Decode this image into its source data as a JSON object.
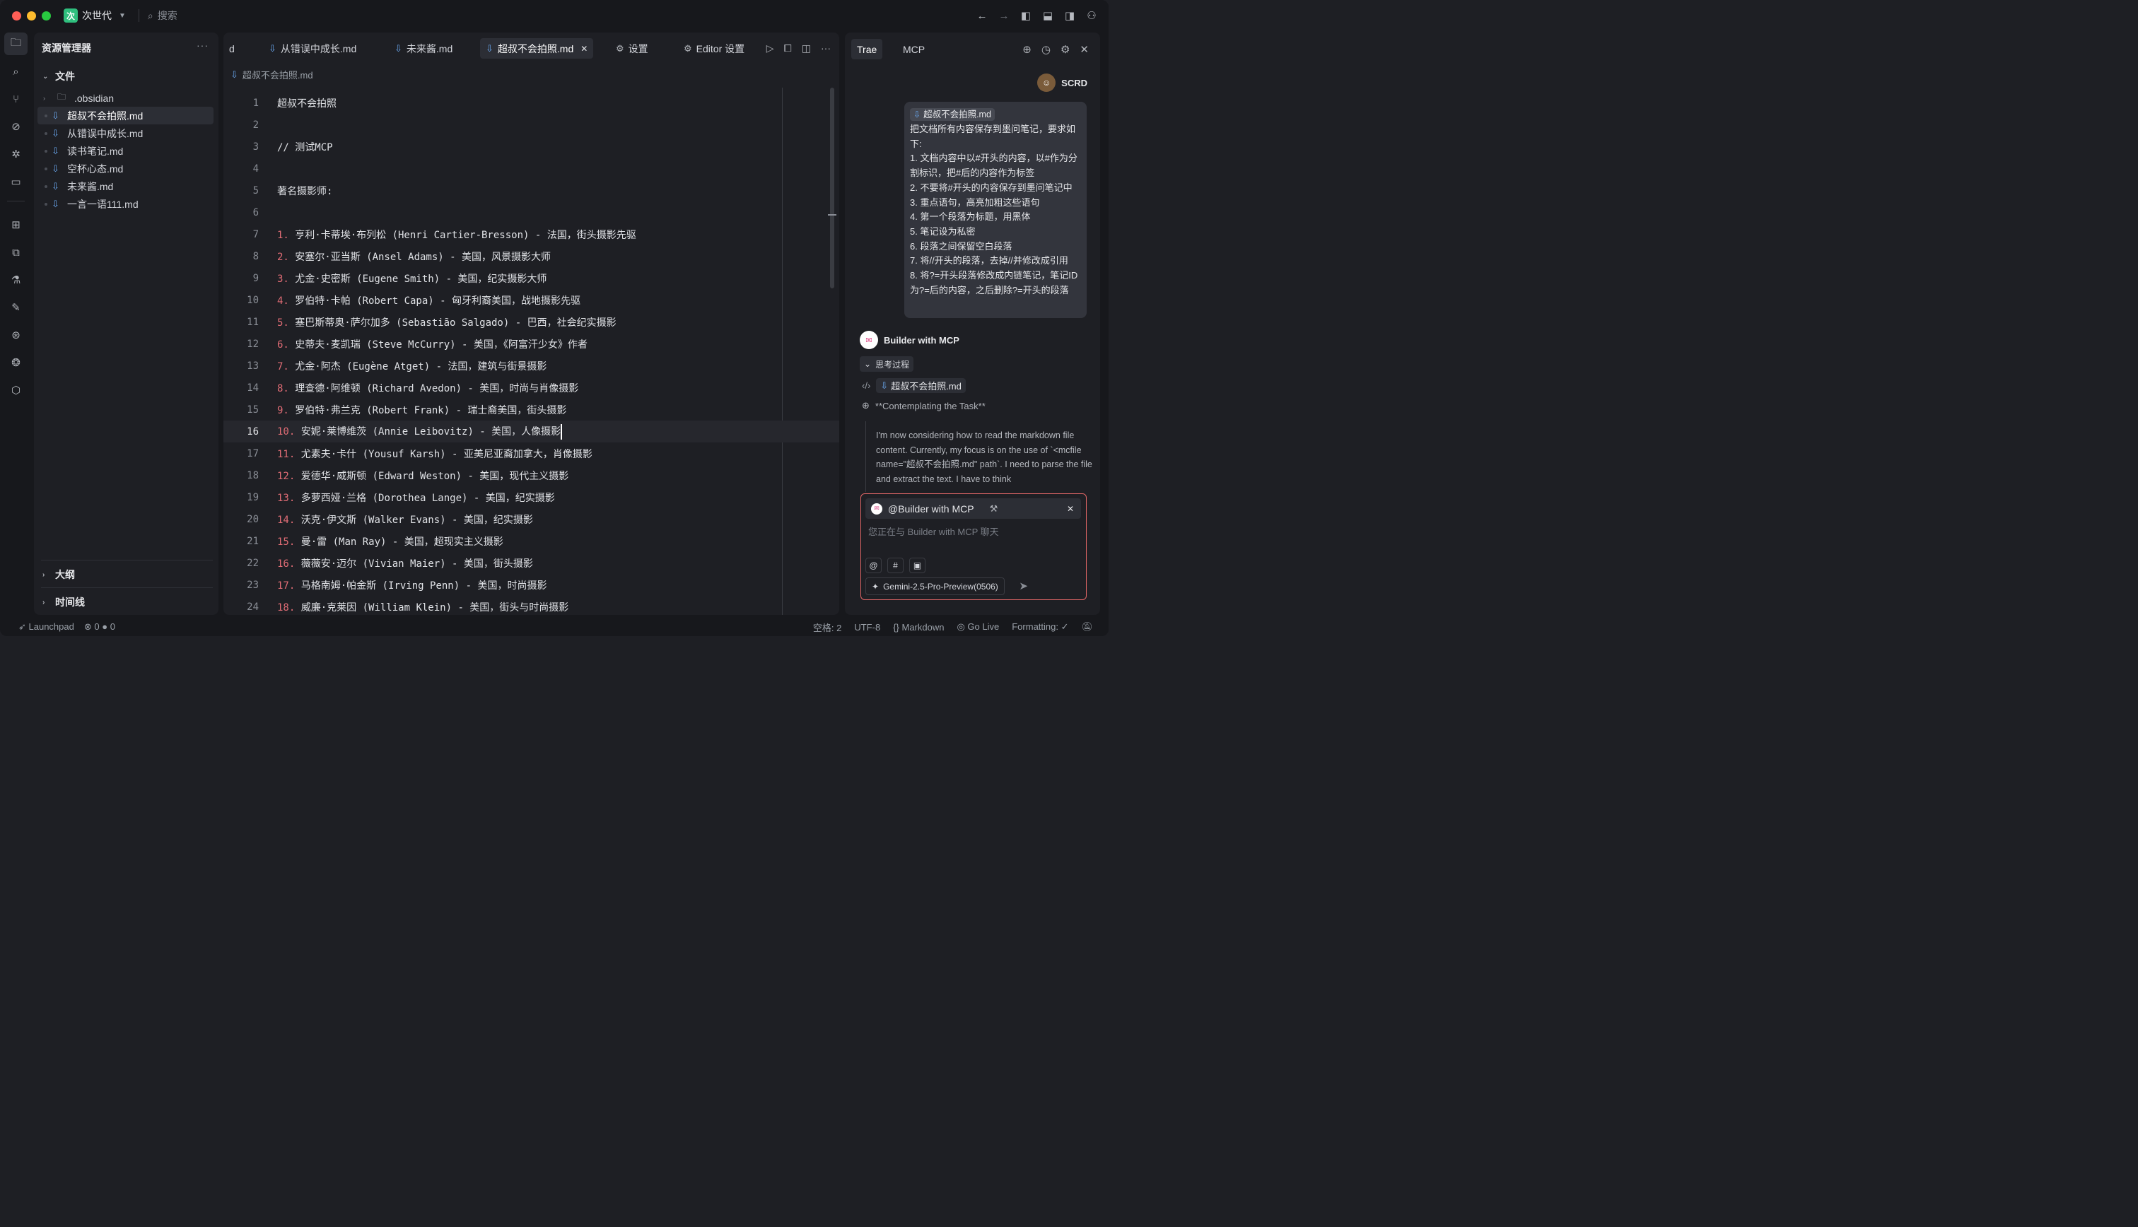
{
  "titlebar": {
    "project_logo": "次",
    "project_name": "次世代",
    "search_placeholder": "搜索"
  },
  "sidebar": {
    "title": "资源管理器",
    "files_section": "文件",
    "tree": [
      {
        "label": ".obsidian",
        "type": "folder"
      },
      {
        "label": "超叔不会拍照.md",
        "type": "file",
        "selected": true
      },
      {
        "label": "从错误中成长.md",
        "type": "file"
      },
      {
        "label": "读书笔记.md",
        "type": "file"
      },
      {
        "label": "空杯心态.md",
        "type": "file"
      },
      {
        "label": "未来酱.md",
        "type": "file"
      },
      {
        "label": "一言一语111.md",
        "type": "file"
      }
    ],
    "outline_section": "大纲",
    "timeline_section": "时间线"
  },
  "editor": {
    "tabs": [
      {
        "label": "d"
      },
      {
        "label": "从错误中成长.md"
      },
      {
        "label": "未来酱.md"
      },
      {
        "label": "超叔不会拍照.md",
        "active": true
      },
      {
        "label": "设置"
      },
      {
        "label": "Editor 设置"
      }
    ],
    "breadcrumb": "超叔不会拍照.md",
    "current_line": 16,
    "lines": [
      {
        "n": "1",
        "no": "",
        "text": "超叔不会拍照"
      },
      {
        "n": "2",
        "no": "",
        "text": ""
      },
      {
        "n": "3",
        "no": "",
        "text": "// 测试MCP"
      },
      {
        "n": "4",
        "no": "",
        "text": ""
      },
      {
        "n": "5",
        "no": "",
        "text": "著名摄影师:"
      },
      {
        "n": "6",
        "no": "",
        "text": ""
      },
      {
        "n": "7",
        "no": "1.",
        "text": " 亨利·卡蒂埃·布列松 (Henri Cartier-Bresson) - 法国，街头摄影先驱"
      },
      {
        "n": "8",
        "no": "2.",
        "text": " 安塞尔·亚当斯 (Ansel Adams) - 美国，风景摄影大师"
      },
      {
        "n": "9",
        "no": "3.",
        "text": " 尤金·史密斯 (Eugene Smith) - 美国，纪实摄影大师"
      },
      {
        "n": "10",
        "no": "4.",
        "text": " 罗伯特·卡帕 (Robert Capa) - 匈牙利裔美国，战地摄影先驱"
      },
      {
        "n": "11",
        "no": "5.",
        "text": " 塞巴斯蒂奥·萨尔加多 (Sebastião Salgado) - 巴西，社会纪实摄影"
      },
      {
        "n": "12",
        "no": "6.",
        "text": " 史蒂夫·麦凯瑞 (Steve McCurry) - 美国，《阿富汗少女》作者"
      },
      {
        "n": "13",
        "no": "7.",
        "text": " 尤金·阿杰 (Eugène Atget) - 法国，建筑与街景摄影"
      },
      {
        "n": "14",
        "no": "8.",
        "text": " 理查德·阿维顿 (Richard Avedon) - 美国，时尚与肖像摄影"
      },
      {
        "n": "15",
        "no": "9.",
        "text": " 罗伯特·弗兰克 (Robert Frank) - 瑞士裔美国，街头摄影"
      },
      {
        "n": "16",
        "no": "10.",
        "text": " 安妮·莱博维茨 (Annie Leibovitz) - 美国，人像摄影"
      },
      {
        "n": "17",
        "no": "11.",
        "text": " 尤素夫·卡什 (Yousuf Karsh) - 亚美尼亚裔加拿大，肖像摄影"
      },
      {
        "n": "18",
        "no": "12.",
        "text": " 爱德华·威斯顿 (Edward Weston) - 美国，现代主义摄影"
      },
      {
        "n": "19",
        "no": "13.",
        "text": " 多萝西娅·兰格 (Dorothea Lange) - 美国，纪实摄影"
      },
      {
        "n": "20",
        "no": "14.",
        "text": " 沃克·伊文斯 (Walker Evans) - 美国，纪实摄影"
      },
      {
        "n": "21",
        "no": "15.",
        "text": " 曼·雷 (Man Ray) - 美国，超现实主义摄影"
      },
      {
        "n": "22",
        "no": "16.",
        "text": " 薇薇安·迈尔 (Vivian Maier) - 美国，街头摄影"
      },
      {
        "n": "23",
        "no": "17.",
        "text": " 马格南姆·帕金斯 (Irving Penn) - 美国，时尚摄影"
      },
      {
        "n": "24",
        "no": "18.",
        "text": " 威廉·克莱因 (William Klein) - 美国，街头与时尚摄影"
      }
    ]
  },
  "chat": {
    "tabs": [
      "Trae",
      "MCP"
    ],
    "user_name": "SCRD",
    "user_message": {
      "file": "超叔不会拍照.md",
      "text": "把文档所有内容保存到墨问笔记，要求如下:\n1. 文档内容中以#开头的内容，以#作为分割标识，把#后的内容作为标签\n2. 不要将#开头的内容保存到墨问笔记中\n3. 重点语句，高亮加粗这些语句\n4. 第一个段落为标题，用黑体\n5. 笔记设为私密\n6. 段落之间保留空白段落\n7. 将//开头的段落，去掉//并修改成引用\n8. 将?=开头段落修改成内链笔记，笔记ID为?=后的内容，之后删除?=开头的段落"
    },
    "bot_name": "Builder with MCP",
    "thinking_label": "思考过程",
    "tool_file": "超叔不会拍照.md",
    "task_title": "**Contemplating the Task**",
    "reasoning": "I'm now considering how to read the markdown file content. Currently, my focus is on the use of `<mcfile name=\"超叔不会拍照.md\" path`. I need to parse the file and extract the text. I have to think",
    "composer": {
      "agent": "@Builder with MCP",
      "placeholder": "您正在与 Builder with MCP 聊天",
      "buttons": [
        "@",
        "#",
        "▣"
      ],
      "model": "Gemini-2.5-Pro-Preview(0506)"
    }
  },
  "statusbar": {
    "launchpad": "Launchpad",
    "errors": "0",
    "warnings": "0",
    "spaces": "空格: 2",
    "encoding": "UTF-8",
    "language": "Markdown",
    "golive": "Go Live",
    "formatting": "Formatting: ✓"
  }
}
